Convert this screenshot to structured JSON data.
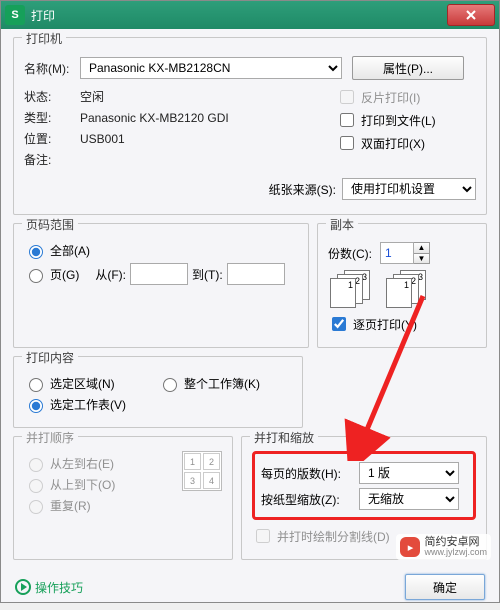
{
  "titlebar": {
    "icon": "S",
    "title": "打印"
  },
  "printer": {
    "legend": "打印机",
    "name_label": "名称(M):",
    "name_value": "Panasonic KX-MB2128CN",
    "props_button": "属性(P)...",
    "status_label": "状态:",
    "status_value": "空闲",
    "type_label": "类型:",
    "type_value": "Panasonic KX-MB2120 GDI",
    "where_label": "位置:",
    "where_value": "USB001",
    "comment_label": "备注:",
    "chk_reverse": "反片打印(I)",
    "chk_tofile": "打印到文件(L)",
    "chk_duplex": "双面打印(X)",
    "source_label": "纸张来源(S):",
    "source_value": "使用打印机设置"
  },
  "range": {
    "legend": "页码范围",
    "all": "全部(A)",
    "pages": "页(G)",
    "from_label": "从(F):",
    "to_label": "到(T):"
  },
  "copies": {
    "legend": "副本",
    "num_label": "份数(C):",
    "num_value": "1",
    "collate": "逐页打印(Y)"
  },
  "content": {
    "legend": "打印内容",
    "selection": "选定区域(N)",
    "workbook": "整个工作簿(K)",
    "sheets": "选定工作表(V)"
  },
  "order": {
    "legend": "并打顺序",
    "lr": "从左到右(E)",
    "td": "从上到下(O)",
    "rep": "重复(R)"
  },
  "scale": {
    "legend": "并打和缩放",
    "per_page_label": "每页的版数(H):",
    "per_page_value": "1 版",
    "zoom_label": "按纸型缩放(Z):",
    "zoom_value": "无缩放",
    "draw_lines": "并打时绘制分割线(D)"
  },
  "footer": {
    "tips": "操作技巧",
    "ok": "确定"
  },
  "watermark": {
    "line1": "简约安卓网",
    "line2": "www.jylzwj.com"
  }
}
